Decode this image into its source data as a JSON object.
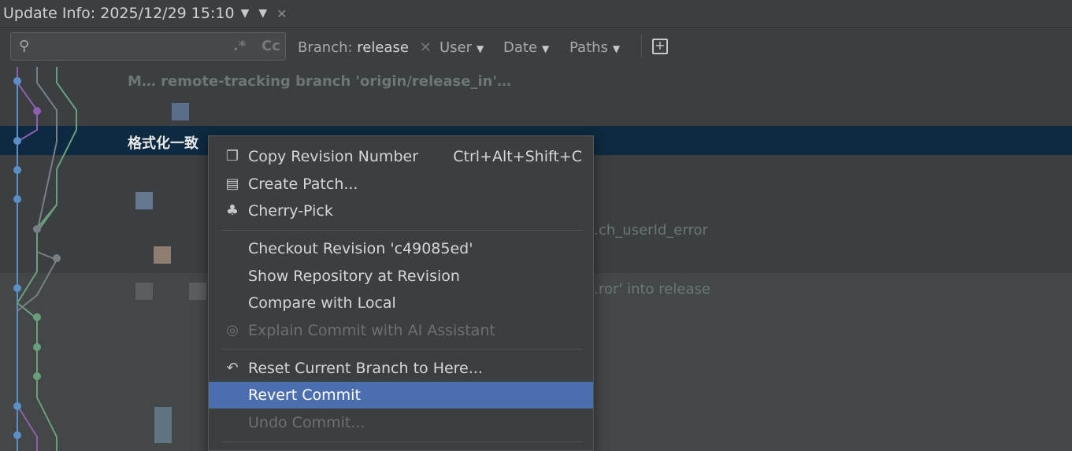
{
  "window": {
    "title": "Update Info: 2025/12/29 15:10",
    "dropdown_icon": "chevron-down-icon",
    "close_icon": "close-icon"
  },
  "toolbar": {
    "search": {
      "value": "",
      "regex_label": ".*",
      "case_label": "Cc"
    },
    "branch_filter": {
      "label": "Branch: ",
      "value": "release"
    },
    "filters": [
      {
        "label": "User"
      },
      {
        "label": "Date"
      },
      {
        "label": "Paths"
      }
    ],
    "new_tab_icon": "add-tab-icon"
  },
  "log": {
    "rows": [
      {
        "message": "M… remote-tracking branch 'origin/release_in'…"
      },
      {
        "message": ""
      },
      {
        "message": "格式化一致"
      },
      {
        "message": ""
      },
      {
        "message": ""
      },
      {
        "message": "…ch_userId_error"
      },
      {
        "message": ""
      },
      {
        "message": "…ror' into release"
      }
    ]
  },
  "context_menu": {
    "items": [
      {
        "label": "Copy Revision Number",
        "shortcut": "Ctrl+Alt+Shift+C",
        "icon": "copy-icon",
        "enabled": true
      },
      {
        "label": "Create Patch...",
        "shortcut": "",
        "icon": "patch-icon",
        "enabled": true
      },
      {
        "label": "Cherry-Pick",
        "shortcut": "",
        "icon": "cherry-icon",
        "enabled": true
      },
      {
        "label": "Checkout Revision 'c49085ed'",
        "shortcut": "",
        "icon": "",
        "enabled": true
      },
      {
        "label": "Show Repository at Revision",
        "shortcut": "",
        "icon": "",
        "enabled": true
      },
      {
        "label": "Compare with Local",
        "shortcut": "",
        "icon": "",
        "enabled": true
      },
      {
        "label": "Explain Commit with AI Assistant",
        "shortcut": "",
        "icon": "ai-assistant-icon",
        "enabled": false
      },
      {
        "label": "Reset Current Branch to Here...",
        "shortcut": "",
        "icon": "reset-icon",
        "enabled": true
      },
      {
        "label": "Revert Commit",
        "shortcut": "",
        "icon": "",
        "enabled": true,
        "highlighted": true
      },
      {
        "label": "Undo Commit...",
        "shortcut": "",
        "icon": "",
        "enabled": false
      }
    ]
  },
  "colors": {
    "selection_row": "#0d2a40",
    "menu_highlight": "#4b6eaf",
    "graph_blue": "#5b8fc7",
    "graph_purple": "#8e5fb0",
    "graph_green": "#6a9f7e",
    "graph_gray": "#7a7f86"
  }
}
